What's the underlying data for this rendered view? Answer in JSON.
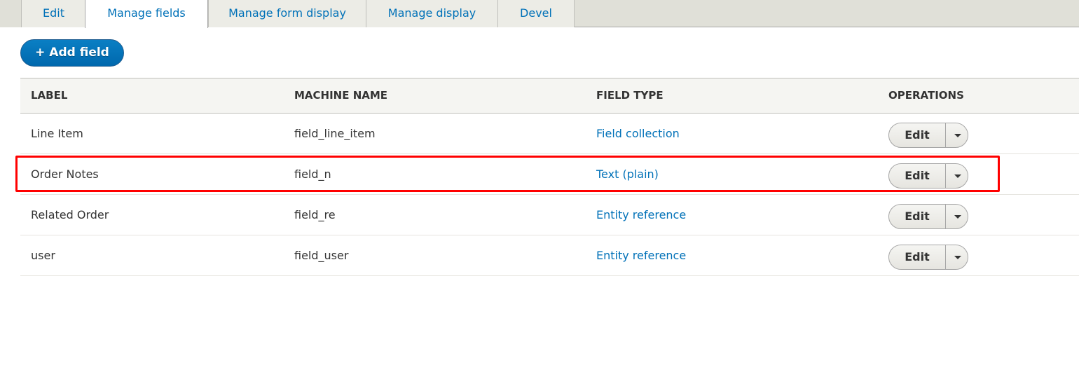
{
  "tabs": [
    {
      "label": "Edit",
      "active": false
    },
    {
      "label": "Manage fields",
      "active": true
    },
    {
      "label": "Manage form display",
      "active": false
    },
    {
      "label": "Manage display",
      "active": false
    },
    {
      "label": "Devel",
      "active": false
    }
  ],
  "add_button": {
    "label": "+ Add field"
  },
  "table": {
    "headers": [
      "LABEL",
      "MACHINE NAME",
      "FIELD TYPE",
      "OPERATIONS"
    ],
    "rows": [
      {
        "label": "Line Item",
        "machine_name": "field_line_item",
        "field_type": "Field collection",
        "operation": "Edit"
      },
      {
        "label": "Order Notes",
        "machine_name": "field_n",
        "field_type": "Text (plain)",
        "operation": "Edit",
        "highlighted": true
      },
      {
        "label": "Related Order",
        "machine_name": "field_re",
        "field_type": "Entity reference",
        "operation": "Edit"
      },
      {
        "label": "user",
        "machine_name": "field_user",
        "field_type": "Entity reference",
        "operation": "Edit"
      }
    ]
  },
  "colors": {
    "link": "#0071b8",
    "primary_button": "#0074bd",
    "highlight": "#ff0000"
  }
}
